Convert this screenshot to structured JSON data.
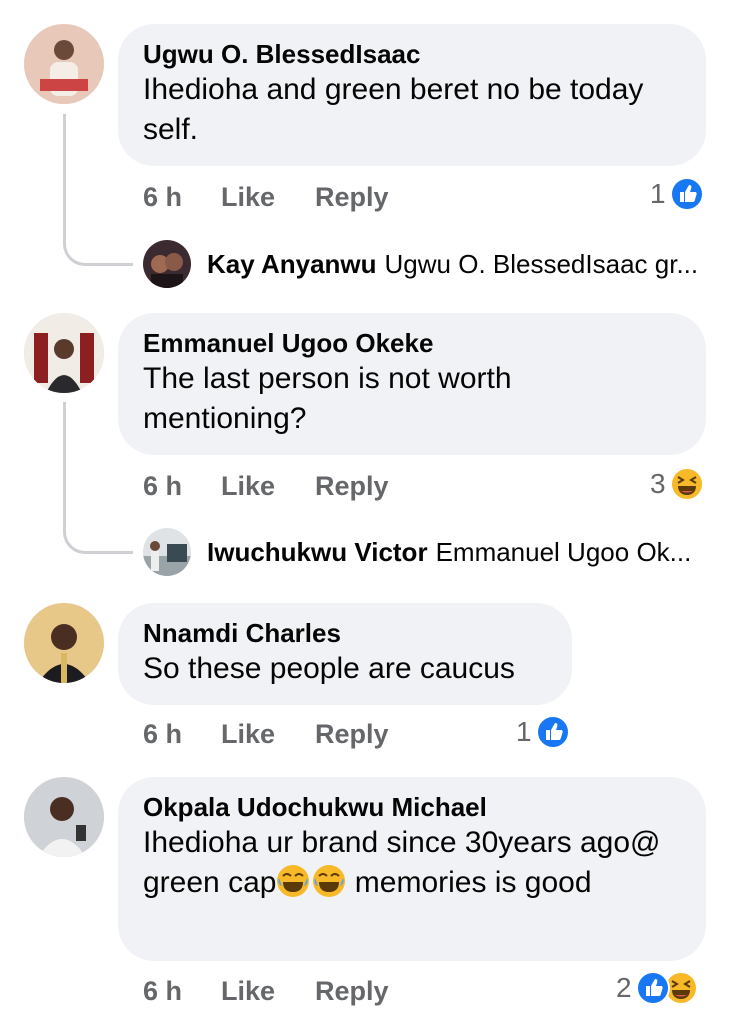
{
  "comments": [
    {
      "author": "Ugwu O. BlessedIsaac",
      "text": "Ihedioha and green beret no be today self.",
      "time": "6 h",
      "like": "Like",
      "reply": "Reply",
      "reaction_count": "1",
      "reactions": [
        "like-icon"
      ],
      "reply_preview": {
        "author": "Kay Anyanwu",
        "text": "Ugwu O. BlessedIsaac gr..."
      }
    },
    {
      "author": "Emmanuel Ugoo Okeke",
      "text": "The last person is not worth mentioning?",
      "time": "6 h",
      "like": "Like",
      "reply": "Reply",
      "reaction_count": "3",
      "reactions": [
        "haha-icon"
      ],
      "reply_preview": {
        "author": "Iwuchukwu Victor",
        "text": "Emmanuel Ugoo Ok..."
      }
    },
    {
      "author": "Nnamdi Charles",
      "text": "So these people are caucus",
      "time": "6 h",
      "like": "Like",
      "reply": "Reply",
      "reaction_count": "1",
      "reactions": [
        "like-icon"
      ]
    },
    {
      "author": "Okpala Udochukwu Michael",
      "text_part1": "Ihedioha ur brand since 30years ago@ green cap",
      "text_part2": " memories is good",
      "emojis": [
        "tears-of-joy-emoji",
        "tears-of-joy-emoji"
      ],
      "time": "6 h",
      "like": "Like",
      "reply": "Reply",
      "reaction_count": "2",
      "reactions": [
        "like-icon",
        "haha-icon"
      ]
    }
  ],
  "colors": {
    "bubble": "#f0f2f5",
    "meta_text": "#65676b",
    "like_blue": "#1877f2",
    "haha_yellow": "#f7b928",
    "thread_line": "#ced0d4"
  }
}
